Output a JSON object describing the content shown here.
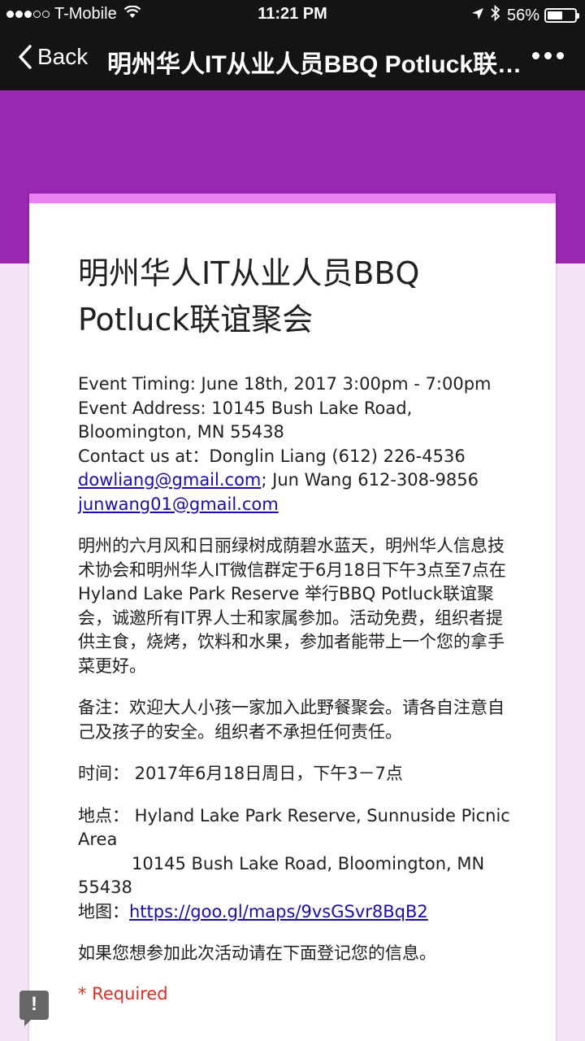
{
  "status_bar": {
    "carrier": "T-Mobile",
    "time": "11:21 PM",
    "battery": "56%",
    "battery_level": 0.56
  },
  "nav": {
    "back_label": "Back",
    "title": "明州华人IT从业人员BBQ Potluck联谊聚会"
  },
  "form": {
    "title": "明州华人IT从业人员BBQ Potluck联谊聚会",
    "event_timing": "Event Timing: June 18th, 2017 3:00pm - 7:00pm",
    "event_address": "Event Address: 10145 Bush Lake Road, Bloomington, MN 55438",
    "contact_prefix": "Contact us at：Donglin Liang (612) 226-4536",
    "email1": "dowliang@gmail.com",
    "contact_mid": "; Jun Wang 612-308-9856",
    "email2": "junwang01@gmail.com",
    "intro": "明州的六月风和日丽绿树成荫碧水蓝天，明州华人信息技术协会和明州华人IT微信群定于6月18日下午3点至7点在 Hyland Lake Park Reserve 举行BBQ Potluck联谊聚会，诚邀所有IT界人士和家属参加。活动免费，组织者提供主食，烧烤，饮料和水果，参加者能带上一个您的拿手菜更好。",
    "note": "备注：欢迎大人小孩一家加入此野餐聚会。请各自注意自己及孩子的安全。组织者不承担任何责任。",
    "time": "时间： 2017年6月18日周日，下午3－7点",
    "location": "地点： Hyland Lake Park Reserve, Sunnuside Picnic Area",
    "location_address": "10145 Bush Lake Road, Bloomington, MN 55438",
    "map_label": "地图：",
    "map_link": "https://goo.gl/maps/9vsGSvr8BqB2",
    "register_prompt": "如果您想参加此次活动请在下面登记您的信息。",
    "required": "* Required"
  },
  "colors": {
    "header_purple": "#9927b0",
    "card_accent": "#e980f0",
    "background": "#f3e5f5",
    "required_red": "#d93025",
    "link_blue": "#1a0dab"
  }
}
